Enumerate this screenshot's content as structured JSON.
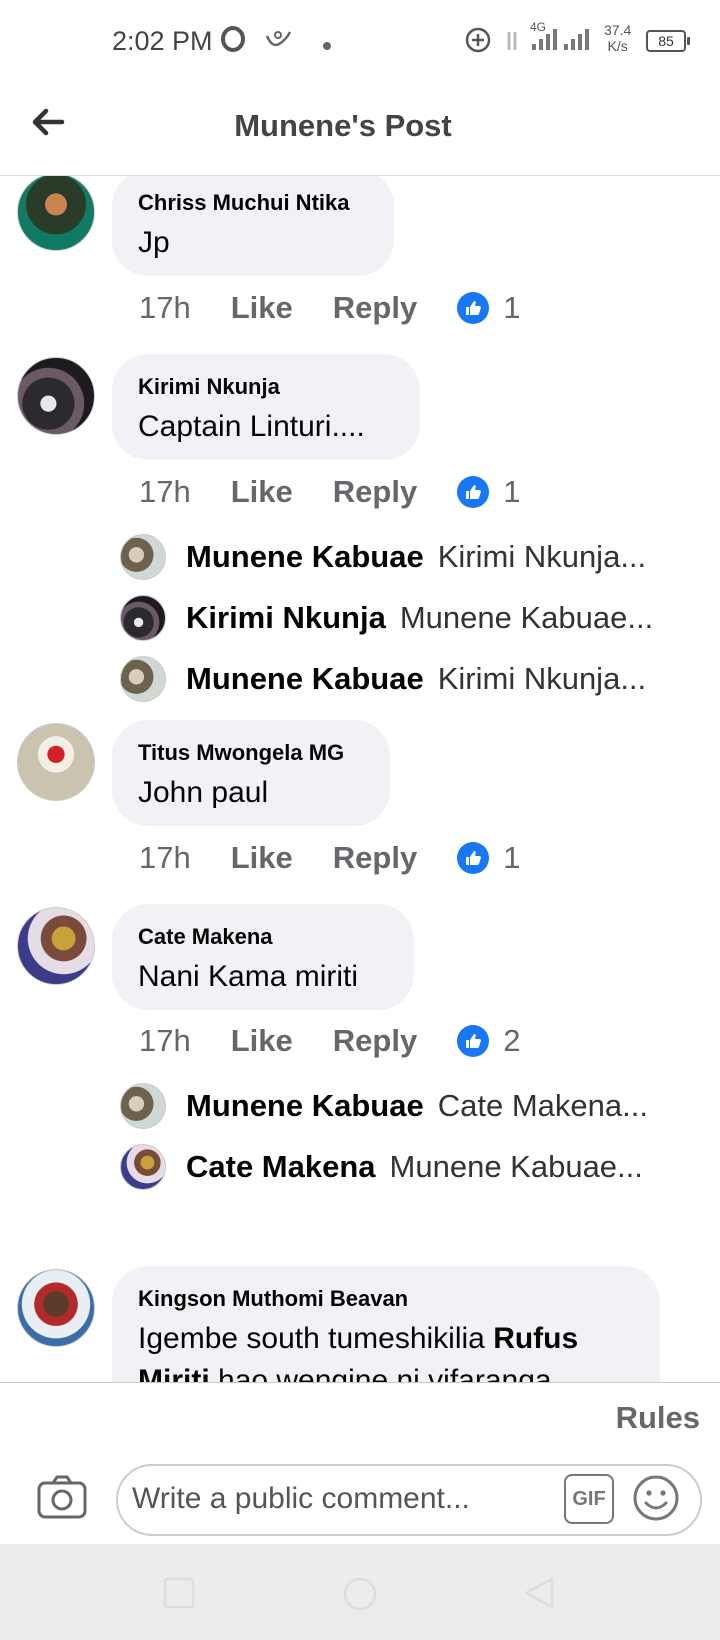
{
  "status_bar": {
    "time": "2:02 PM",
    "network_type": "4G",
    "net_speed_value": "37.4",
    "net_speed_unit": "K/s",
    "battery": "85"
  },
  "header": {
    "title": "Munene's Post",
    "back_icon": "arrow-left-icon"
  },
  "comments": [
    {
      "author": "Chriss Muchui Ntika",
      "text": "Jp",
      "time": "17h",
      "like_label": "Like",
      "reply_label": "Reply",
      "reactions": "1",
      "replies": []
    },
    {
      "author": "Kirimi Nkunja",
      "text": "Captain Linturi....",
      "time": "17h",
      "like_label": "Like",
      "reply_label": "Reply",
      "reactions": "1",
      "replies": [
        {
          "author": "Munene Kabuae",
          "text": "Kirimi Nkunja..."
        },
        {
          "author": "Kirimi Nkunja",
          "text": "Munene Kabuae..."
        },
        {
          "author": "Munene Kabuae",
          "text": "Kirimi Nkunja..."
        }
      ]
    },
    {
      "author": "Titus Mwongela MG",
      "text": "John paul",
      "time": "17h",
      "like_label": "Like",
      "reply_label": "Reply",
      "reactions": "1",
      "replies": []
    },
    {
      "author": "Cate Makena",
      "text": "Nani Kama miriti",
      "time": "17h",
      "like_label": "Like",
      "reply_label": "Reply",
      "reactions": "2",
      "replies": [
        {
          "author": "Munene Kabuae",
          "text": "Cate Makena..."
        },
        {
          "author": "Cate Makena",
          "text": "Munene Kabuae..."
        }
      ]
    },
    {
      "author": "Kingson Muthomi Beavan",
      "text_before": "Igembe south tumeshikilia ",
      "text_bold": "Rufus",
      "line2_bold": "Miriti",
      "line2_rest": " hao wengine ni vifaranga"
    }
  ],
  "footer": {
    "rules_label": "Rules",
    "comment_placeholder": "Write a public comment...",
    "gif_label": "GIF",
    "camera_icon": "camera-icon",
    "emoji_icon": "emoji-icon"
  },
  "colors": {
    "bubble_bg": "#f0f2f5",
    "like_blue": "#1877f2",
    "meta_gray": "#65676b"
  }
}
